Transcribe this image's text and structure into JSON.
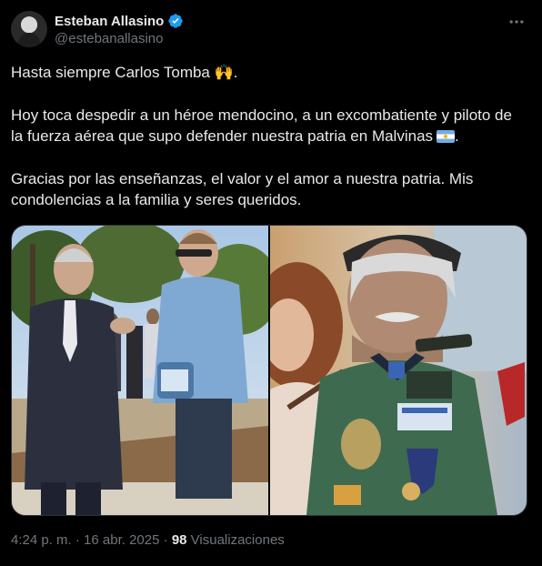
{
  "author": {
    "name": "Esteban Allasino",
    "handle": "@estebanallasino"
  },
  "tweet": {
    "line1": "Hasta siempre Carlos Tomba 🙌.",
    "paragraph2": "Hoy toca despedir a un héroe mendocino, a un excombatiente y piloto de la fuerza aérea que supo defender nuestra patria en Malvinas",
    "paragraph3": "Gracias por las enseñanzas, el valor y el amor a nuestra patria. Mis condolencias a la familia y seres queridos."
  },
  "meta": {
    "time": "4:24 p. m.",
    "separator": "·",
    "date": "16 abr. 2025",
    "views_count": "98",
    "views_label": "Visualizaciones"
  },
  "icons": {
    "verified": "verified-badge-icon",
    "more": "more-options-icon"
  },
  "colors": {
    "background": "#000000",
    "text": "#e7e9ea",
    "secondary": "#71767b",
    "verified": "#1d9bf0"
  }
}
